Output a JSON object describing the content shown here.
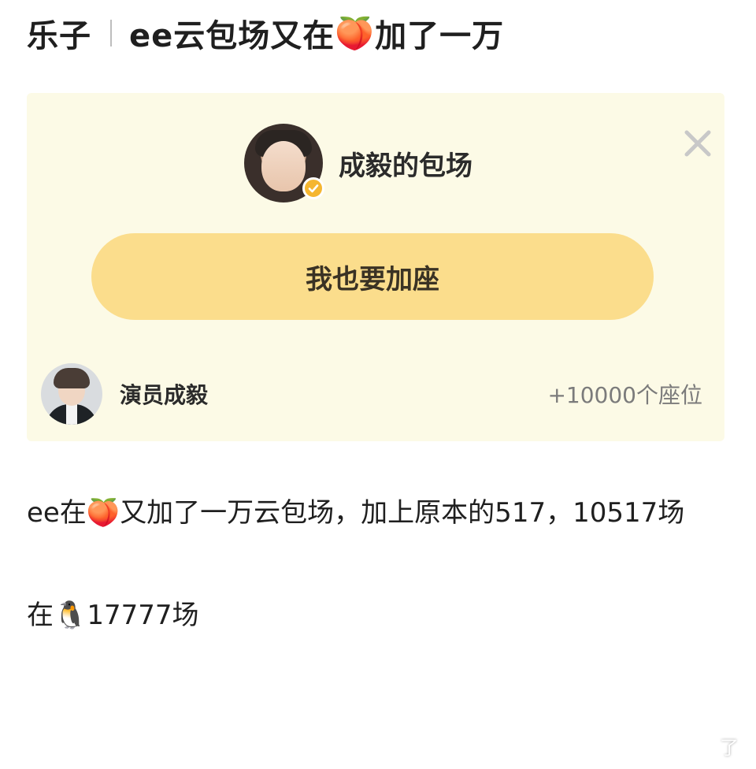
{
  "post": {
    "title_left": "乐子",
    "title_right_prefix": "ee云包场又在",
    "title_emoji": "🍑",
    "title_right_suffix": "加了一万"
  },
  "card": {
    "host_name": "成毅的包场",
    "join_button_label": "我也要加座",
    "contributor_name": "演员成毅",
    "contributor_seats": "+10000个座位",
    "colors": {
      "background": "#fcfae6",
      "button": "#fbdd8c",
      "verified_badge": "#f5b630"
    },
    "icons": {
      "close": "close-icon",
      "verified": "verified-badge-icon"
    }
  },
  "body": {
    "line1_prefix": "ee在",
    "line1_emoji": "🍑",
    "line1_suffix": "又加了一万云包场，加上原本的517，10517场",
    "line2_prefix": "在",
    "line2_emoji": "🐧",
    "line2_suffix": "17777场"
  },
  "watermark": "了"
}
